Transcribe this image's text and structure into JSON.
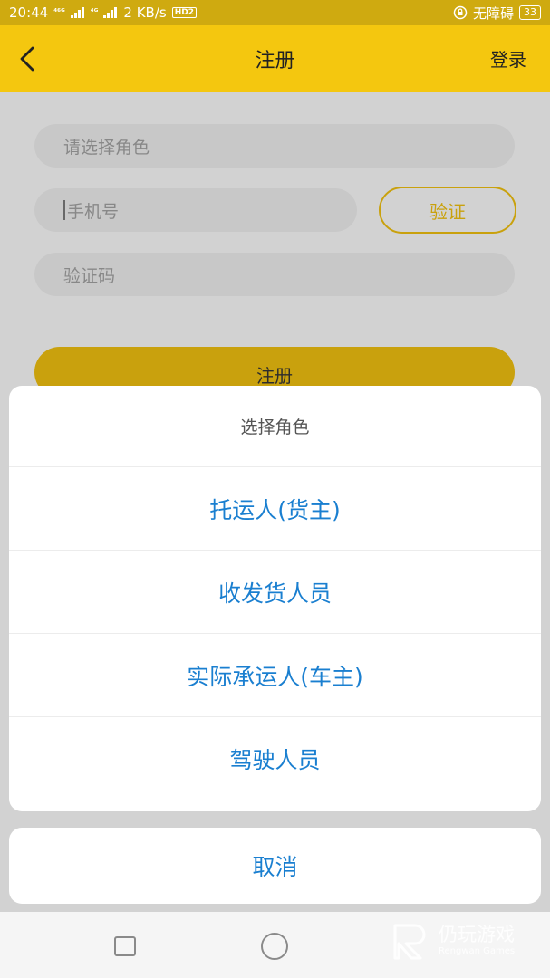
{
  "status_bar": {
    "time": "20:44",
    "network_1": "⁴⁶ᴳ",
    "network_2": "⁴ᴳ",
    "speed": "2 KB/s",
    "hd": "HD2",
    "accessibility": "无障碍",
    "battery": "33"
  },
  "app_bar": {
    "title": "注册",
    "login_label": "登录"
  },
  "form": {
    "role_placeholder": "请选择角色",
    "phone_placeholder": "手机号",
    "code_placeholder": "验证码",
    "verify_label": "验证",
    "register_label": "注册"
  },
  "sheet": {
    "title": "选择角色",
    "options": [
      "托运人(货主)",
      "收发货人员",
      "实际承运人(车主)",
      "驾驶人员"
    ],
    "cancel_label": "取消"
  },
  "watermark": {
    "cn": "仍玩游戏",
    "en": "Rengwan Games"
  },
  "colors": {
    "accent": "#f4c70f",
    "option_blue": "#1a7fd0"
  }
}
